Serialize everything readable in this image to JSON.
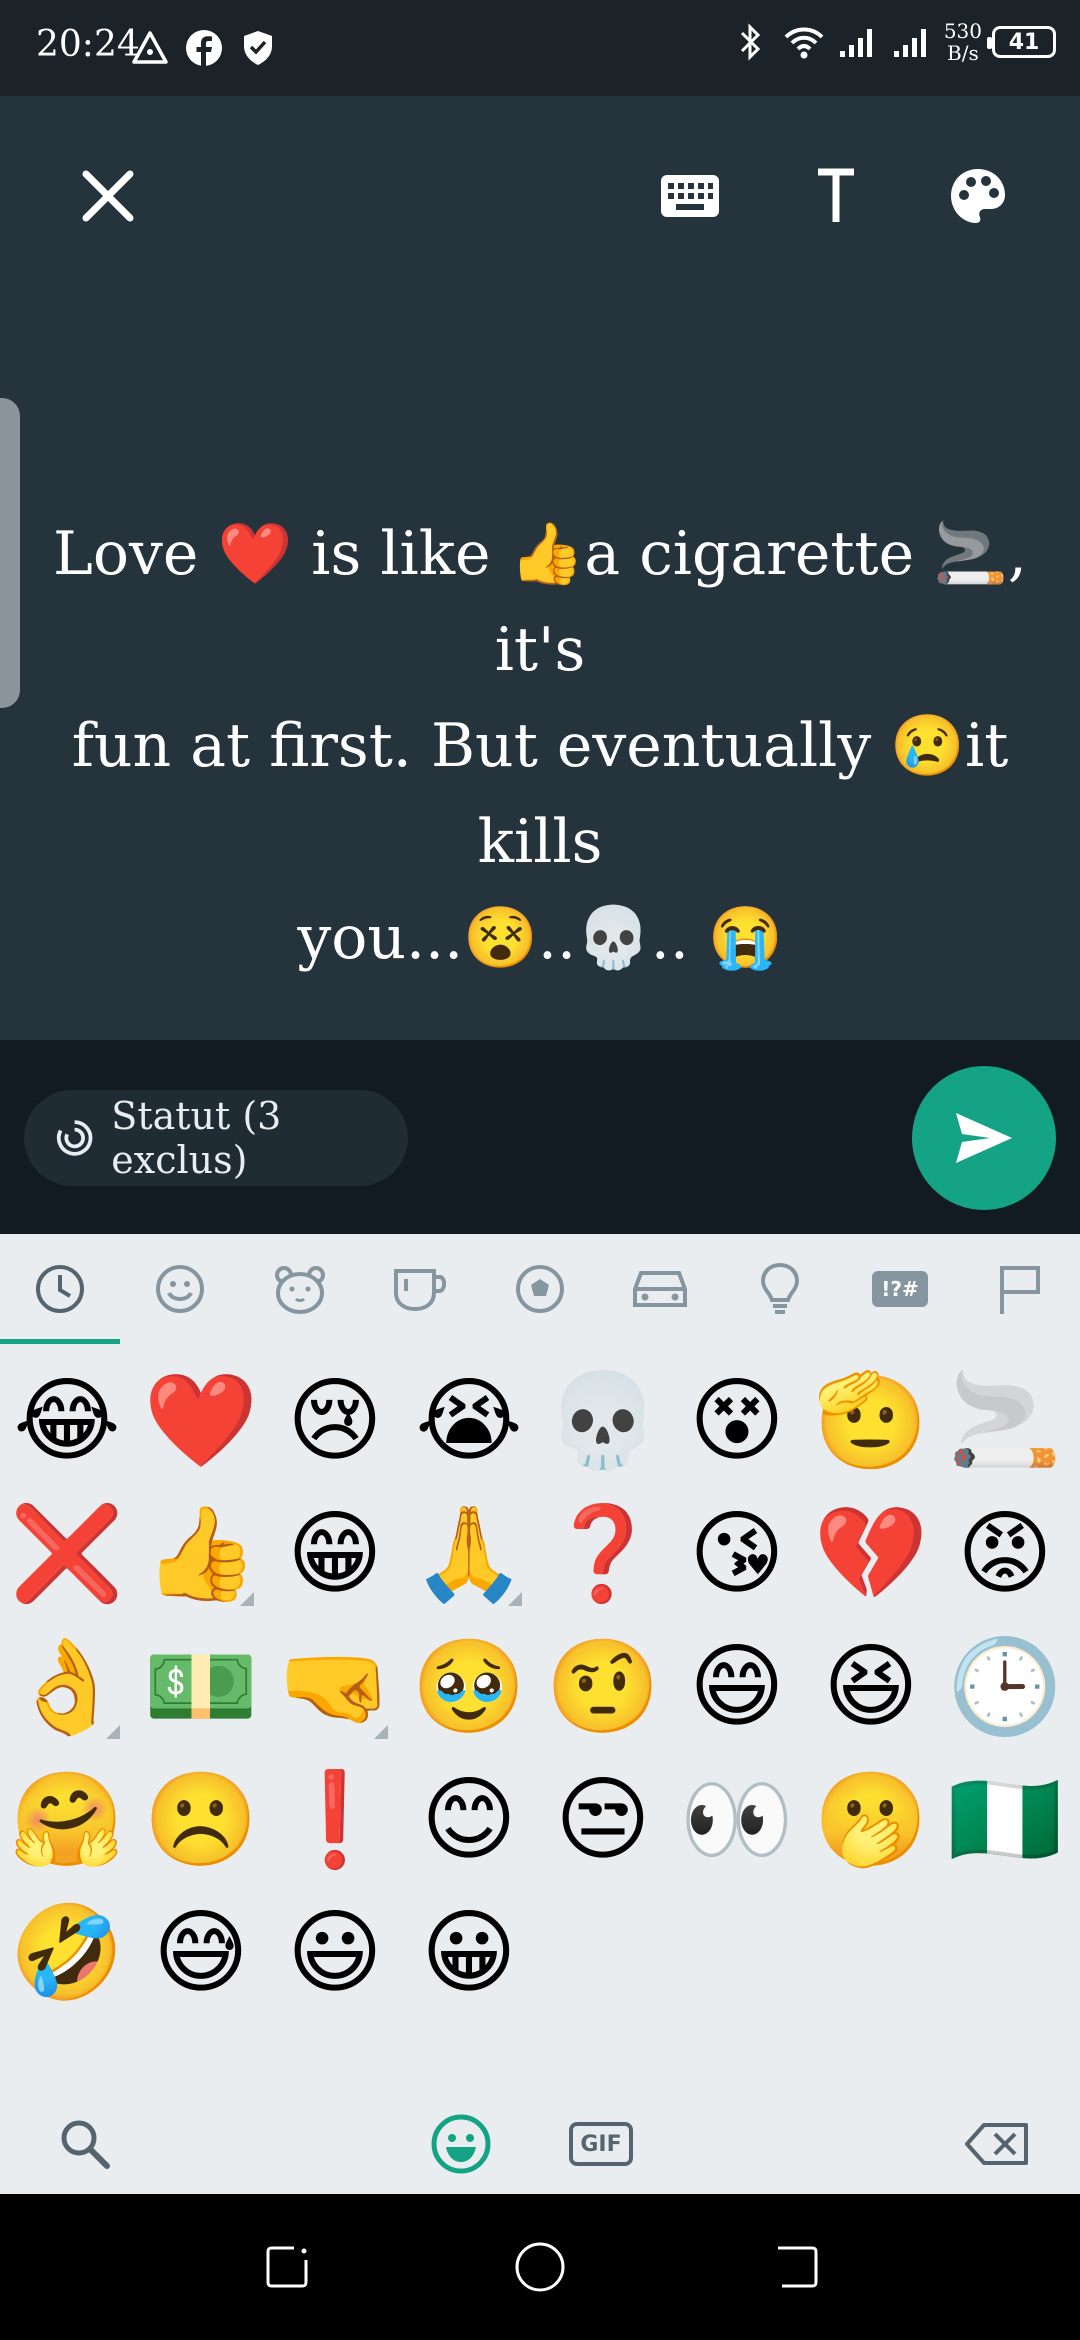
{
  "status_bar": {
    "time": "20:24",
    "net_speed_value": "530",
    "net_speed_unit": "B/s",
    "battery": "41",
    "icons_left": [
      "triangle-icon",
      "facebook-icon",
      "shield-check-icon"
    ],
    "icons_right": [
      "bluetooth-icon",
      "wifi-icon",
      "signal-1-icon",
      "signal-2-icon",
      "battery-icon"
    ]
  },
  "editor": {
    "status_lines": [
      "Love ❤️ is like 👍a cigarette 🚬, it's",
      "fun at first. But eventually 😢it kills",
      "you...😵..💀.. 😭"
    ],
    "toolbar": [
      "close-icon",
      "keyboard-icon",
      "text-style-icon",
      "palette-icon"
    ]
  },
  "compose": {
    "audience_label": "Statut (3 exclus)"
  },
  "emoji_keyboard": {
    "categories": [
      "recent",
      "smileys",
      "animals",
      "food",
      "activities",
      "travel",
      "objects",
      "symbols",
      "flags"
    ],
    "symbols_label": "!?#",
    "emojis": [
      "😂",
      "❤️",
      "😢",
      "😭",
      "💀",
      "😵",
      "🫡",
      "🚬",
      "❌",
      "👍",
      "😁",
      "🙏",
      "❓",
      "😘",
      "💔",
      "😡",
      "👌",
      "💵",
      "🤜",
      "🥹",
      "🤨",
      "😄",
      "😆",
      "🕒",
      "🤗",
      "☹️",
      "❗",
      "😊",
      "😒",
      "👀",
      "🫢",
      "🇳🇬",
      "🤣",
      "😅",
      "😃",
      "😀"
    ],
    "variant_indices": [
      9,
      11,
      16,
      18
    ],
    "gif_label": "GIF"
  },
  "colors": {
    "accent": "#15a385",
    "editor_bg": "#25333d",
    "compose_bg": "#111b21",
    "keyboard_bg": "#e9edf0"
  }
}
